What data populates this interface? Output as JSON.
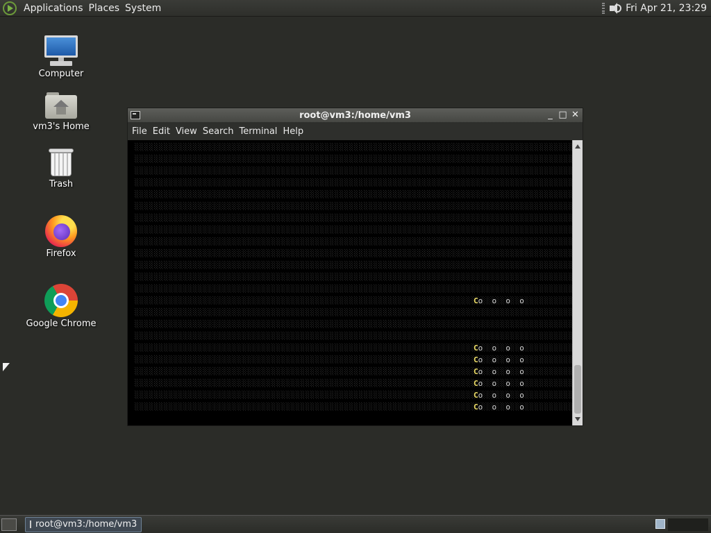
{
  "top_panel": {
    "menus": [
      "Applications",
      "Places",
      "System"
    ],
    "clock": "Fri Apr 21, 23:29",
    "icons": [
      "distro-logo-icon",
      "volume-icon"
    ]
  },
  "desktop": {
    "icons": [
      {
        "label": "Computer",
        "icon": "computer-icon"
      },
      {
        "label": "vm3's Home",
        "icon": "home-folder-icon"
      },
      {
        "label": "Trash",
        "icon": "trash-icon"
      },
      {
        "label": "Firefox",
        "icon": "firefox-icon"
      },
      {
        "label": "Google Chrome",
        "icon": "chrome-icon"
      }
    ]
  },
  "terminal": {
    "title": "root@vm3:/home/vm3",
    "window_buttons": [
      "_",
      "□",
      "✕"
    ],
    "menus": [
      "File",
      "Edit",
      "View",
      "Search",
      "Terminal",
      "Help"
    ],
    "pacman_rows": [
      {
        "stars": ""
      },
      {
        "stars": ""
      },
      {
        "stars": ""
      },
      {
        "stars": ""
      },
      {
        "stars": ""
      },
      {
        "stars": ""
      },
      {
        "stars": ""
      },
      {
        "stars": ""
      },
      {
        "stars": ""
      },
      {
        "stars": ""
      },
      {
        "stars": ""
      },
      {
        "stars": ""
      },
      {
        "stars": ""
      },
      {
        "stars": "Co  o  o  o"
      },
      {
        "stars": ""
      },
      {
        "stars": ""
      },
      {
        "stars": ""
      },
      {
        "stars": "Co  o  o  o"
      },
      {
        "stars": "Co  o  o  o"
      },
      {
        "stars": "Co  o  o  o"
      },
      {
        "stars": "Co  o  o  o"
      },
      {
        "stars": "Co  o  o  o"
      },
      {
        "stars": "Co  o  o  o"
      }
    ]
  },
  "bottom_panel": {
    "task": "root@vm3:/home/vm3"
  },
  "colors": {
    "desktop_bg": "#2b2c28",
    "terminal_bg": "#000000",
    "pacman": "#f3e36a"
  }
}
